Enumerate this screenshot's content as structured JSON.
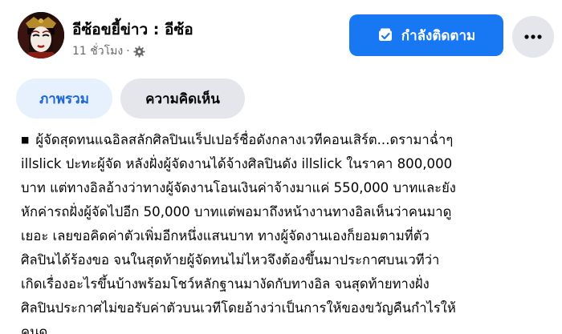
{
  "header": {
    "page_name": "อีซ้อขยี้ข่าว : อีซ้อ",
    "timestamp": "11 ชั่วโมง",
    "separator": "·",
    "privacy_icon": "gear-icon",
    "avatar_icon": "avatar"
  },
  "actions": {
    "follow_label": "กำลังติดตาม",
    "follow_icon": "following-icon",
    "more_icon": "more-dots-icon"
  },
  "tabs": [
    {
      "label": "ภาพรวม",
      "active": true
    },
    {
      "label": "ความคิดเห็น",
      "active": false
    }
  ],
  "post": {
    "bullet": "■",
    "text": "ผู้จัดสุดทนแฉอิลสลักศิลปินแร็ปเปอร์ชื่อดังกลางเวทีคอนเสิร์ต...ดรามาฉ่ำๆ\nillslick ปะทะผู้จัด หลังฝั่งผู้จัดงานได้จ้างศิลปินดัง illslick ในราคา 800,000\nบาท แต่ทางอิลอ้างว่าทางผู้จัดงานโอนเงินค่าจ้างมาแค่ 550,000 บาทและยัง\nหักค่ารถฝั่งผู้จัดไปอีก 50,000 บาทแต่พอมาถึงหน้างานทางอิลเห็นว่าคนมาดู\nเยอะ เลยขอคิดค่าตัวเพิ่มอีกหนึ่งแสนบาท ทางผู้จัดงานเองก็ยอมตามที่ตัว\nศิลปินได้ร้องขอ จนในสุดท้ายผู้จัดทนไม่ไหวจึงต้องขึ้นมาประกาศบนเวทีว่า\nเกิดเรื่องอะไรขึ้นบ้างพร้อมโชว์หลักฐานมางัดกับทางอิล จนสุดท้ายทางฝั่ง\nศิลปินประกาศไม่ขอรับค่าตัวบนเวทีโดยอ้างว่าเป็นการให้ของขวัญคืนกำไรให้\nคนดู"
  },
  "colors": {
    "accent": "#1877f2",
    "tab_active_bg": "#e7f0fd",
    "tab_active_text": "#1b65d6",
    "button_gray": "#e4e6eb",
    "secondary_text": "#65676b"
  }
}
